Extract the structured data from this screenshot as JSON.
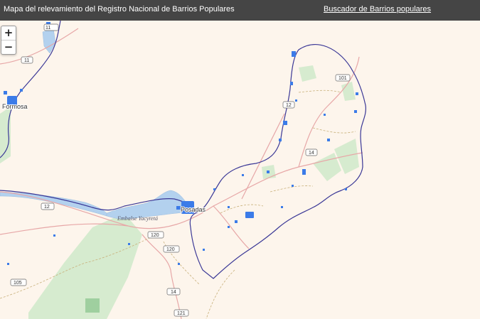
{
  "header": {
    "title": "Mapa del relevamiento del Registro Nacional de Barrios Populares",
    "search_link": "Buscador de Barrios populares"
  },
  "zoom": {
    "in_label": "+",
    "out_label": "−"
  },
  "map": {
    "cities": {
      "formosa": "Formosa",
      "posadas": "Posadas"
    },
    "water_label": "Embalse Yacyretá",
    "road_labels": {
      "r1": "11",
      "r2": "11",
      "r3": "101",
      "r4": "12",
      "r5": "14",
      "r6": "12",
      "r7": "120",
      "r8": "120",
      "r9": "14",
      "r10": "121",
      "r11": "105"
    },
    "colors": {
      "background": "#fdf5ec",
      "border": "#3a3796",
      "barrios": "#3b7be8",
      "parks": "#cfe8c8",
      "water": "#b3d1ee"
    }
  }
}
